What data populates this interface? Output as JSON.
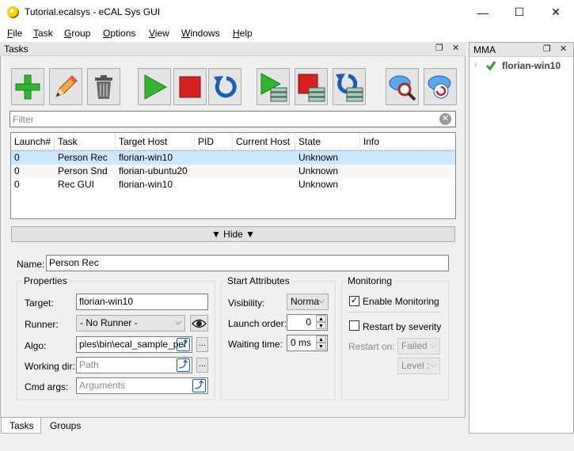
{
  "window": {
    "title": "Tutorial.ecalsys - eCAL Sys GUI",
    "controls": {
      "minimize": "—",
      "maximize": "☐",
      "close": "✕"
    }
  },
  "menu": [
    {
      "label": "File",
      "mnemonic": "F"
    },
    {
      "label": "Task",
      "mnemonic": "T"
    },
    {
      "label": "Group",
      "mnemonic": "G"
    },
    {
      "label": "Options",
      "mnemonic": "O"
    },
    {
      "label": "View",
      "mnemonic": "V"
    },
    {
      "label": "Windows",
      "mnemonic": "W"
    },
    {
      "label": "Help",
      "mnemonic": "H"
    }
  ],
  "tasks_dock": {
    "title": "Tasks",
    "float_icon": "❐",
    "close_icon": "✕"
  },
  "toolbar": [
    {
      "icon": "add-icon"
    },
    {
      "icon": "edit-icon"
    },
    {
      "icon": "trash-icon"
    },
    {
      "icon": "start-icon"
    },
    {
      "icon": "stop-icon"
    },
    {
      "icon": "restart-icon"
    },
    {
      "icon": "start-all-icon"
    },
    {
      "icon": "stop-all-icon"
    },
    {
      "icon": "restart-all-icon"
    },
    {
      "icon": "cloud-search-icon"
    },
    {
      "icon": "cloud-refresh-icon"
    }
  ],
  "filter": {
    "placeholder": "Filter",
    "value": "",
    "clear_icon": "✕"
  },
  "table": {
    "sort_indicator": "^",
    "columns": [
      "Launch#",
      "Task",
      "Target Host",
      "PID",
      "Current Host",
      "State",
      "Info"
    ],
    "rows": [
      {
        "launch": "0",
        "task": "Person Rec",
        "target_host": "florian-win10",
        "pid": "",
        "current_host": "",
        "state": "Unknown",
        "info": "",
        "selected": true
      },
      {
        "launch": "0",
        "task": "Person Snd",
        "target_host": "florian-ubuntu20",
        "pid": "",
        "current_host": "",
        "state": "Unknown",
        "info": "",
        "selected": false
      },
      {
        "launch": "0",
        "task": "Rec GUI",
        "target_host": "florian-win10",
        "pid": "",
        "current_host": "",
        "state": "Unknown",
        "info": "",
        "selected": false
      }
    ]
  },
  "hide_bar": {
    "label": "▼ Hide ▼"
  },
  "details": {
    "name_label": "Name:",
    "name_value": "Person Rec",
    "properties": {
      "title": "Properties",
      "target_label": "Target:",
      "target_value": "florian-win10",
      "runner_label": "Runner:",
      "runner_value": "- No Runner -",
      "algo_label": "Algo:",
      "algo_value": "ples\\bin\\ecal_sample_per",
      "working_dir_label": "Working dir:",
      "working_dir_placeholder": "Path",
      "cmd_args_label": "Cmd args:",
      "cmd_args_placeholder": "Arguments",
      "browse_label": "..."
    },
    "start_attributes": {
      "title": "Start Attributes",
      "visibility_label": "Visibility:",
      "visibility_value": "Norma",
      "launch_order_label": "Launch order:",
      "launch_order_value": "0",
      "waiting_time_label": "Waiting time:",
      "waiting_time_value": "0 ms"
    },
    "monitoring": {
      "title": "Monitoring",
      "enable_label": "Enable Monitoring",
      "enable_checked": true,
      "restart_label": "Restart by severity",
      "restart_checked": false,
      "restart_on_label": "Restart on:",
      "restart_on_value": "Failed",
      "level_value": "Level :"
    }
  },
  "bottom_tabs": [
    {
      "label": "Tasks",
      "active": true
    },
    {
      "label": "Groups",
      "active": false
    }
  ],
  "mma_dock": {
    "title": "MMA",
    "float_icon": "❐",
    "close_icon": "✕",
    "hosts": [
      {
        "name": "florian-win10",
        "status": "ok"
      }
    ]
  },
  "colors": {
    "selected_row": "#cce8ff",
    "green": "#2fb52f",
    "red": "#d42020",
    "blue": "#1a5fb4"
  }
}
